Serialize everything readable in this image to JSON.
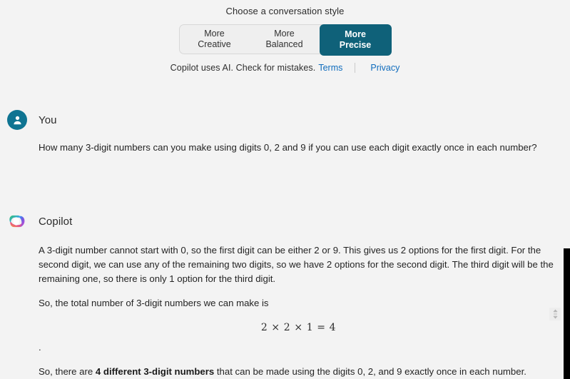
{
  "style_picker": {
    "title": "Choose a conversation style",
    "options": [
      {
        "line1": "More",
        "line2": "Creative",
        "selected": false
      },
      {
        "line1": "More",
        "line2": "Balanced",
        "selected": false
      },
      {
        "line1": "More",
        "line2": "Precise",
        "selected": true
      }
    ],
    "selected_color": "#0f6179"
  },
  "legal": {
    "disclaimer": "Copilot uses AI. Check for mistakes.",
    "terms_label": "Terms",
    "privacy_label": "Privacy",
    "link_color": "#0f6cbd"
  },
  "conversation": {
    "user": {
      "author": "You",
      "avatar_icon": "person-icon",
      "avatar_color": "#0f7492",
      "message": "How many 3-digit numbers can you make using digits 0, 2 and 9 if you can use each digit exactly once in each number?"
    },
    "assistant": {
      "author": "Copilot",
      "avatar_icon": "copilot-logo-icon",
      "paragraph_1": "A 3-digit number cannot start with 0, so the first digit can be either 2 or 9. This gives us 2 options for the first digit. For the second digit, we can use any of the remaining two digits, so we have 2 options for the second digit. The third digit will be the remaining one, so there is only 1 option for the third digit.",
      "paragraph_2": "So, the total number of 3-digit numbers we can make is",
      "math_expression": "2 × 2 × 1 = 4",
      "trailing_punctuation": ".",
      "conclusion_prefix": "So, there are ",
      "conclusion_bold": "4 different 3-digit numbers",
      "conclusion_suffix": " that can be made using the digits 0, 2, and 9 exactly once in each number."
    }
  },
  "handle": {
    "icon": "vertical-resize-handle-icon"
  }
}
